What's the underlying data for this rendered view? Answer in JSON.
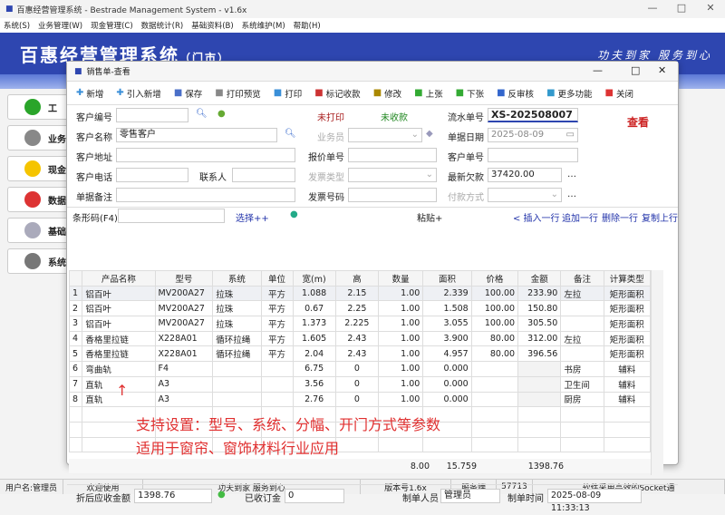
{
  "app": {
    "title": "百惠经营管理系统 - Bestrade Management System - v1.6x",
    "menu": [
      "系统(S)",
      "业务管理(W)",
      "现金管理(C)",
      "数据统计(R)",
      "基础资料(B)",
      "系统维护(M)",
      "帮助(H)"
    ],
    "banner_title": "百惠经营管理系统",
    "banner_sub": "（门市）",
    "slogan": "功夫到家 服务到心",
    "sidebar": [
      {
        "label": "工",
        "icon": "check-icon",
        "color": "#2aa52a"
      },
      {
        "label": "业务",
        "icon": "printer-icon",
        "color": "#888"
      },
      {
        "label": "现金",
        "icon": "star-icon",
        "color": "#f5c400"
      },
      {
        "label": "数据",
        "icon": "bar-chart-icon",
        "color": "#d33"
      },
      {
        "label": "基础",
        "icon": "tag-icon",
        "color": "#aab"
      },
      {
        "label": "系统",
        "icon": "gear-icon",
        "color": "#777"
      }
    ],
    "status": [
      "用户名:管理员",
      "欢迎使用",
      "功夫到家 服务到心",
      "版本号1.6x",
      "服务端",
      "57713",
      "软件采用高效的Socket通"
    ]
  },
  "dialog": {
    "title": "销售单-查看",
    "toolbar": [
      {
        "label": "新增",
        "icon": "plus-icon"
      },
      {
        "label": "引入新增",
        "icon": "import-plus-icon"
      },
      {
        "label": "保存",
        "icon": "save-icon"
      },
      {
        "label": "打印预览",
        "icon": "print-preview-icon"
      },
      {
        "label": "打印",
        "icon": "print-icon"
      },
      {
        "label": "标记收款",
        "icon": "mark-paid-icon"
      },
      {
        "label": "修改",
        "icon": "edit-icon"
      },
      {
        "label": "上张",
        "icon": "prev-icon"
      },
      {
        "label": "下张",
        "icon": "next-icon"
      },
      {
        "label": "反审核",
        "icon": "unaudit-icon"
      },
      {
        "label": "更多功能",
        "icon": "more-icon"
      },
      {
        "label": "关闭",
        "icon": "close-icon"
      }
    ],
    "form": {
      "cust_no": "客户编号",
      "cust_name": "客户名称",
      "cust_name_val": "零售客户",
      "cust_addr": "客户地址",
      "cust_tel": "客户电话",
      "contact": "联系人",
      "remark": "单据备注",
      "print_status": "未打印",
      "pay_status": "未收款",
      "salesman": "业务员",
      "quote_no": "报价单号",
      "invoice_type": "发票类型",
      "invoice_no": "发票号码",
      "serial_no": "流水单号",
      "serial_no_val": "XS-202508007",
      "date": "单据日期",
      "date_val": "2025-08-09",
      "cust_order": "客户单号",
      "debt": "最新欠款",
      "debt_val": "37420.00",
      "pay_method": "付款方式",
      "mode": "查看",
      "barcode": "条形码(F4)",
      "select": "选择++",
      "paste": "粘贴+",
      "insert_row": "< 插入一行",
      "append_row": "追加一行",
      "delete_row": "删除一行",
      "copy_row": "复制上行"
    },
    "grid": {
      "columns": [
        "",
        "产品名称",
        "型号",
        "系统",
        "单位",
        "宽(m)",
        "高",
        "数量",
        "面积",
        "价格",
        "金额",
        "备注",
        "计算类型"
      ],
      "rows": [
        [
          "1",
          "铝百叶",
          "MV200A27",
          "拉珠",
          "平方",
          "1.088",
          "2.15",
          "1.00",
          "2.339",
          "100.00",
          "233.90",
          "左拉",
          "矩形面积"
        ],
        [
          "2",
          "铝百叶",
          "MV200A27",
          "拉珠",
          "平方",
          "0.67",
          "2.25",
          "1.00",
          "1.508",
          "100.00",
          "150.80",
          "",
          "矩形面积"
        ],
        [
          "3",
          "铝百叶",
          "MV200A27",
          "拉珠",
          "平方",
          "1.373",
          "2.225",
          "1.00",
          "3.055",
          "100.00",
          "305.50",
          "",
          "矩形面积"
        ],
        [
          "4",
          "香格里拉链",
          "X228A01",
          "循环拉绳",
          "平方",
          "1.605",
          "2.43",
          "1.00",
          "3.900",
          "80.00",
          "312.00",
          "左拉",
          "矩形面积"
        ],
        [
          "5",
          "香格里拉链",
          "X228A01",
          "循环拉绳",
          "平方",
          "2.04",
          "2.43",
          "1.00",
          "4.957",
          "80.00",
          "396.56",
          "",
          "矩形面积"
        ],
        [
          "6",
          "弯曲轨",
          "F4",
          "",
          "",
          "6.75",
          "0",
          "1.00",
          "0.000",
          "",
          "",
          "书房",
          "辅料"
        ],
        [
          "7",
          "直轨",
          "A3",
          "",
          "",
          "3.56",
          "0",
          "1.00",
          "0.000",
          "",
          "",
          "卫生间",
          "辅料"
        ],
        [
          "8",
          "直轨",
          "A3",
          "",
          "",
          "2.76",
          "0",
          "1.00",
          "0.000",
          "",
          "",
          "厨房",
          "辅料"
        ]
      ],
      "totals": {
        "qty": "8.00",
        "area": "15.759",
        "amount": "1398.76"
      }
    },
    "note": [
      "支持设置：型号、系统、分幅、开门方式等参数",
      "适用于窗帘、窗饰材料行业应用"
    ],
    "footer": {
      "net_label": "折后应收金额",
      "net_val": "1398.76",
      "deposit_label": "已收订金",
      "deposit_val": "0",
      "maker_label": "制单人员",
      "maker_val": "管理员",
      "time_label": "制单时间",
      "time_val": "2025-08-09 11:33:13"
    }
  }
}
